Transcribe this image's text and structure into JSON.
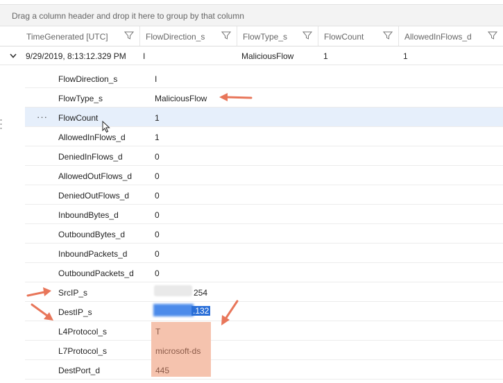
{
  "group_bar": {
    "text": "Drag a column header and drop it here to group by that column"
  },
  "columns": [
    {
      "label": "TimeGenerated [UTC]"
    },
    {
      "label": "FlowDirection_s"
    },
    {
      "label": "FlowType_s"
    },
    {
      "label": "FlowCount"
    },
    {
      "label": "AllowedInFlows_d"
    }
  ],
  "summary_row": {
    "time": "9/29/2019, 8:13:12.329 PM",
    "flow_direction": "I",
    "flow_type": "MaliciousFlow",
    "flow_count": "1",
    "allowed_in_flows": "1"
  },
  "details": [
    {
      "name": "FlowDirection_s",
      "value": "I"
    },
    {
      "name": "FlowType_s",
      "value": "MaliciousFlow"
    },
    {
      "name": "FlowCount",
      "value": "1"
    },
    {
      "name": "AllowedInFlows_d",
      "value": "1"
    },
    {
      "name": "DeniedInFlows_d",
      "value": "0"
    },
    {
      "name": "AllowedOutFlows_d",
      "value": "0"
    },
    {
      "name": "DeniedOutFlows_d",
      "value": "0"
    },
    {
      "name": "InboundBytes_d",
      "value": "0"
    },
    {
      "name": "OutboundBytes_d",
      "value": "0"
    },
    {
      "name": "InboundPackets_d",
      "value": "0"
    },
    {
      "name": "OutboundPackets_d",
      "value": "0"
    },
    {
      "name": "SrcIP_s",
      "value": "254"
    },
    {
      "name": "DestIP_s",
      "value": ".132"
    },
    {
      "name": "L4Protocol_s",
      "value": "T"
    },
    {
      "name": "L7Protocol_s",
      "value": "microsoft-ds"
    },
    {
      "name": "DestPort_d",
      "value": "445"
    }
  ],
  "row_menu": {
    "label": "···"
  },
  "colors": {
    "arrow": "#e8765a",
    "highlight_row": "#e6effb",
    "selection": "#2a6fd8",
    "annotation_block": "#f5c3ae"
  },
  "icons": [
    "filter-icon",
    "chevron-down-icon",
    "more-icon",
    "mouse-cursor-icon"
  ]
}
